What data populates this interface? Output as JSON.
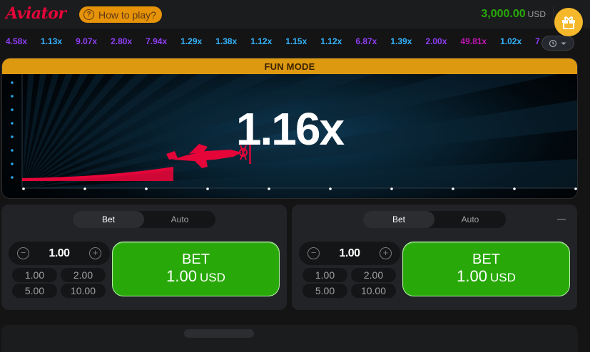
{
  "header": {
    "logo": "Aviator",
    "how_to_play": "How to play?",
    "how_to_play_icon": "?",
    "balance": "3,000.00",
    "currency": "USD",
    "gift_icon": "gift-icon"
  },
  "history": {
    "items": [
      {
        "value": "4.58x",
        "color": "#913ef8"
      },
      {
        "value": "1.13x",
        "color": "#34b4ff"
      },
      {
        "value": "9.07x",
        "color": "#913ef8"
      },
      {
        "value": "2.80x",
        "color": "#913ef8"
      },
      {
        "value": "7.94x",
        "color": "#913ef8"
      },
      {
        "value": "1.29x",
        "color": "#34b4ff"
      },
      {
        "value": "1.38x",
        "color": "#34b4ff"
      },
      {
        "value": "1.12x",
        "color": "#34b4ff"
      },
      {
        "value": "1.15x",
        "color": "#34b4ff"
      },
      {
        "value": "1.12x",
        "color": "#34b4ff"
      },
      {
        "value": "6.87x",
        "color": "#913ef8"
      },
      {
        "value": "1.39x",
        "color": "#34b4ff"
      },
      {
        "value": "2.00x",
        "color": "#913ef8"
      },
      {
        "value": "49.81x",
        "color": "#c017b4"
      },
      {
        "value": "1.02x",
        "color": "#34b4ff"
      },
      {
        "value": "7",
        "color": "#913ef8"
      }
    ],
    "toggle_icons": [
      "history-icon",
      "chevron-down-icon"
    ]
  },
  "game": {
    "mode_banner": "FUN MODE",
    "multiplier": "1.16x",
    "plane_color": "#e50539"
  },
  "panels": [
    {
      "tabs": [
        "Bet",
        "Auto"
      ],
      "active_tab": "Bet",
      "amount": "1.00",
      "quick_amounts": [
        "1.00",
        "2.00",
        "5.00",
        "10.00"
      ],
      "bet_label": "BET",
      "bet_amount": "1.00",
      "bet_currency": "USD"
    },
    {
      "tabs": [
        "Bet",
        "Auto"
      ],
      "active_tab": "Bet",
      "amount": "1.00",
      "quick_amounts": [
        "1.00",
        "2.00",
        "5.00",
        "10.00"
      ],
      "bet_label": "BET",
      "bet_amount": "1.00",
      "bet_currency": "USD"
    }
  ],
  "colors": {
    "accent_green": "#28a909",
    "accent_orange": "#e69308",
    "brand_red": "#e50539"
  }
}
